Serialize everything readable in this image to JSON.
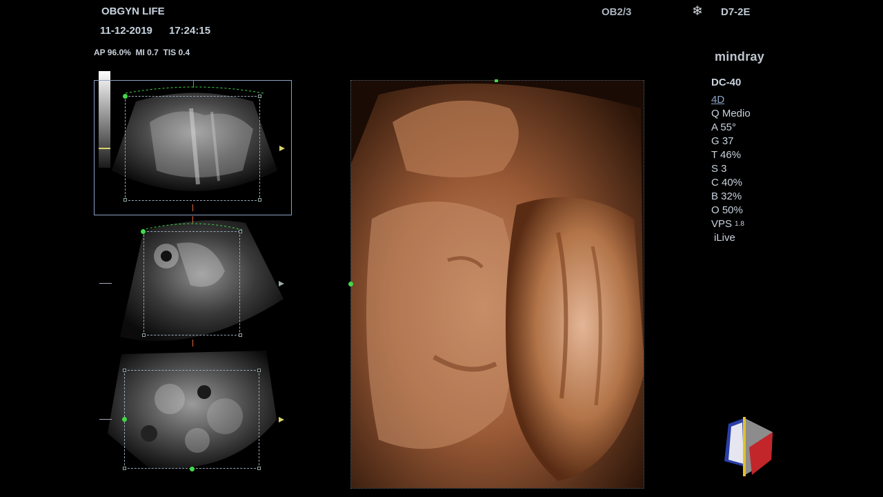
{
  "header": {
    "institution": "OBGYN LIFE",
    "date": "11-12-2019",
    "time": "17:24:15",
    "acoustic": "AP 96.0%  MI 0.7  TIS 0.4",
    "preset": "OB2/3",
    "probe": "D7-2E",
    "freeze_icon": "snowflake-icon"
  },
  "brand": {
    "logo": "mindray",
    "model": "DC-40"
  },
  "params": {
    "mode": "4D",
    "quality": "Q Medio",
    "angle": "A 55°",
    "gain": "G 37",
    "threshold": "T 46%",
    "smooth": "S 3",
    "contrast": "C 40%",
    "brightness": "B 32%",
    "opacity": "O 50%",
    "vps_label": "VPS",
    "vps_value": "1.8",
    "render": "iLive"
  },
  "colors": {
    "render_tone": "#8a4a2a",
    "selection_frame": "#8ea3c4",
    "marker_green": "#41d94a",
    "marker_yellow": "#d9d36b",
    "marker_red": "#e0653c"
  }
}
